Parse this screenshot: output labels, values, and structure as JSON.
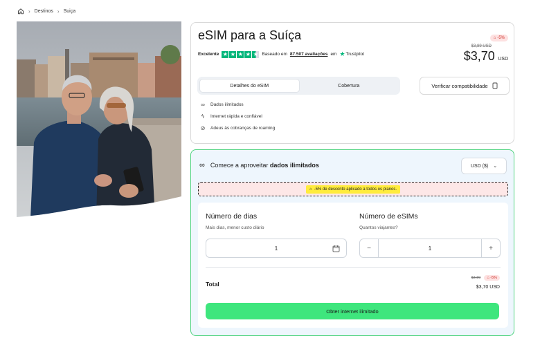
{
  "breadcrumb": {
    "items": [
      "Destinos",
      "Suiça"
    ]
  },
  "product": {
    "title": "eSIM para a Suíça",
    "rating_label": "Excelente",
    "based_on": "Baseado em",
    "reviews": "87.507 avaliações",
    "on": "em",
    "trustpilot": "Trustpilot",
    "discount_badge": "-5%",
    "old_price": "$3,89 USD",
    "price": "$3,70",
    "currency": "USD"
  },
  "tabs": [
    {
      "label": "Detalhes do eSIM",
      "active": true
    },
    {
      "label": "Cobertura",
      "active": false
    }
  ],
  "compat_button": "Verificar compatibilidade",
  "features": [
    {
      "icon": "infinity-icon",
      "label": "Dados ilimitados"
    },
    {
      "icon": "lightning-icon",
      "label": "Internet rápida e confiável"
    },
    {
      "icon": "no-roaming-icon",
      "label": "Adeus às cobranças de roaming"
    }
  ],
  "config": {
    "head_prefix": "Comece a aproveitar",
    "head_bold": "dados ilimitados",
    "currency_select": "USD ($)",
    "promo": "-5% de desconto aplicado a todos os planos.",
    "days_title": "Número de dias",
    "days_sub": "Mais dias, menor custo diário",
    "days_value": "1",
    "esims_title": "Número de eSIMs",
    "esims_sub": "Quantos viajantes?",
    "esims_value": "1",
    "total_label": "Total",
    "total_old": "$3,89",
    "total_badge": "-5%",
    "total_new": "$3,70 USD",
    "cta": "Obter internet ilimitado"
  },
  "colors": {
    "accent_green": "#3ee67d",
    "trustpilot_green": "#00b67a",
    "discount_red": "#d0342c"
  }
}
